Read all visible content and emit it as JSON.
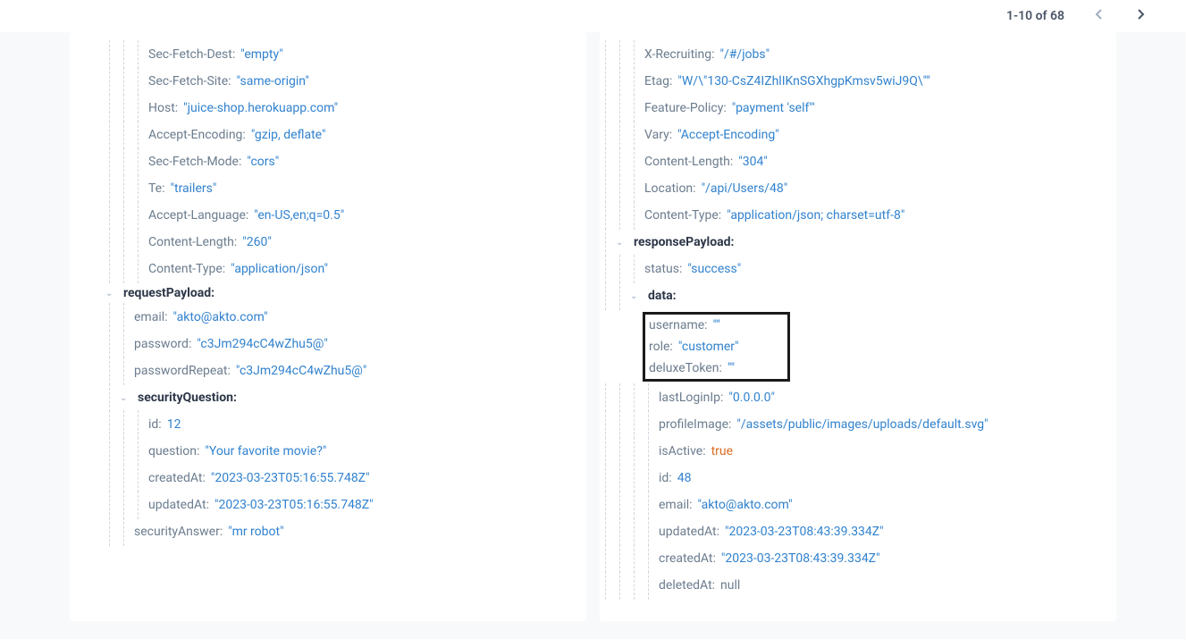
{
  "pagination": {
    "range": "1-10 of 68"
  },
  "left": {
    "headers": [
      {
        "key": "Sec-Fetch-Dest:",
        "val": "\"empty\""
      },
      {
        "key": "Sec-Fetch-Site:",
        "val": "\"same-origin\""
      },
      {
        "key": "Host:",
        "val": "\"juice-shop.herokuapp.com\""
      },
      {
        "key": "Accept-Encoding:",
        "val": "\"gzip, deflate\""
      },
      {
        "key": "Sec-Fetch-Mode:",
        "val": "\"cors\""
      },
      {
        "key": "Te:",
        "val": "\"trailers\""
      },
      {
        "key": "Accept-Language:",
        "val": "\"en-US,en;q=0.5\""
      },
      {
        "key": "Content-Length:",
        "val": "\"260\""
      },
      {
        "key": "Content-Type:",
        "val": "\"application/json\""
      }
    ],
    "requestPayloadLabel": "requestPayload:",
    "payload": [
      {
        "key": "email:",
        "val": "\"akto@akto.com\""
      },
      {
        "key": "password:",
        "val": "\"c3Jm294cC4wZhu5@\""
      },
      {
        "key": "passwordRepeat:",
        "val": "\"c3Jm294cC4wZhu5@\""
      }
    ],
    "securityQuestionLabel": "securityQuestion:",
    "securityQuestion": [
      {
        "key": "id:",
        "val": "12"
      },
      {
        "key": "question:",
        "val": "\"Your favorite movie?\""
      },
      {
        "key": "createdAt:",
        "val": "\"2023-03-23T05:16:55.748Z\""
      },
      {
        "key": "updatedAt:",
        "val": "\"2023-03-23T05:16:55.748Z\""
      }
    ],
    "securityAnswer": {
      "key": "securityAnswer:",
      "val": "\"mr robot\""
    }
  },
  "right": {
    "headers": [
      {
        "key": "X-Recruiting:",
        "val": "\"/#/jobs\""
      },
      {
        "key": "Etag:",
        "val": "\"W/\\\"130-CsZ4IZhlIKnSGXhgpKmsv5wiJ9Q\\\"\""
      },
      {
        "key": "Feature-Policy:",
        "val": "\"payment 'self'\""
      },
      {
        "key": "Vary:",
        "val": "\"Accept-Encoding\""
      },
      {
        "key": "Content-Length:",
        "val": "\"304\""
      },
      {
        "key": "Location:",
        "val": "\"/api/Users/48\""
      },
      {
        "key": "Content-Type:",
        "val": "\"application/json; charset=utf-8\""
      }
    ],
    "responsePayloadLabel": "responsePayload:",
    "status": {
      "key": "status:",
      "val": "\"success\""
    },
    "dataLabel": "data:",
    "boxed": [
      {
        "key": "username:",
        "val": "\"\""
      },
      {
        "key": "role:",
        "val": "\"customer\""
      },
      {
        "key": "deluxeToken:",
        "val": "\"\""
      }
    ],
    "data": [
      {
        "key": "lastLoginIp:",
        "val": "\"0.0.0.0\"",
        "type": "str"
      },
      {
        "key": "profileImage:",
        "val": "\"/assets/public/images/uploads/default.svg\"",
        "type": "str"
      },
      {
        "key": "isActive:",
        "val": "true",
        "type": "bool"
      },
      {
        "key": "id:",
        "val": "48",
        "type": "num"
      },
      {
        "key": "email:",
        "val": "\"akto@akto.com\"",
        "type": "str"
      },
      {
        "key": "updatedAt:",
        "val": "\"2023-03-23T08:43:39.334Z\"",
        "type": "str"
      },
      {
        "key": "createdAt:",
        "val": "\"2023-03-23T08:43:39.334Z\"",
        "type": "str"
      },
      {
        "key": "deletedAt:",
        "val": "null",
        "type": "null"
      }
    ]
  }
}
